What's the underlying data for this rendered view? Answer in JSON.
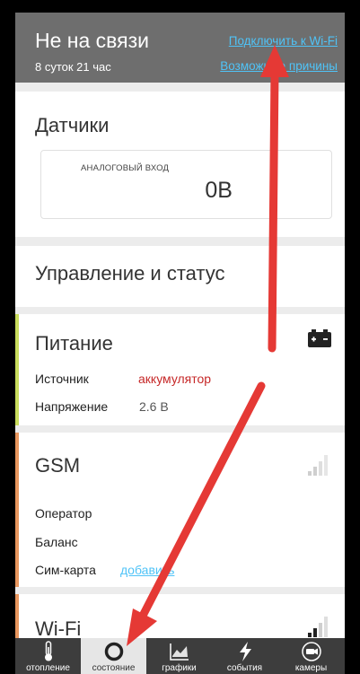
{
  "header": {
    "title": "Не на связи",
    "subtitle": "8 суток 21 час",
    "link_connect": "Подключить к Wi-Fi",
    "link_reasons": "Возможные причины"
  },
  "sensors": {
    "title": "Датчики",
    "analog_label": "АНАЛОГОВЫЙ ВХОД",
    "analog_value": "0В"
  },
  "control": {
    "title": "Управление и статус"
  },
  "power": {
    "title": "Питание",
    "source_label": "Источник",
    "source_value": "аккумулятор",
    "voltage_label": "Напряжение",
    "voltage_value": "2.6 В"
  },
  "gsm": {
    "title": "GSM",
    "operator_label": "Оператор",
    "balance_label": "Баланс",
    "sim_label": "Сим-карта",
    "sim_link": "добавить"
  },
  "wifi": {
    "title": "Wi-Fi"
  },
  "nav": {
    "items": [
      {
        "label": "отопление",
        "icon": "thermometer-icon"
      },
      {
        "label": "состояние",
        "icon": "ring-icon"
      },
      {
        "label": "графики",
        "icon": "chart-icon"
      },
      {
        "label": "события",
        "icon": "lightning-icon"
      },
      {
        "label": "камеры",
        "icon": "camera-icon"
      }
    ],
    "active_index": 1
  },
  "colors": {
    "accent_link": "#4fc3f7",
    "header_bg": "#6e6e6e",
    "power_stripe": "#c9dc5c",
    "gsm_stripe": "#e8965e",
    "warning_text": "#c62828",
    "annotation_arrow": "#e53935"
  }
}
